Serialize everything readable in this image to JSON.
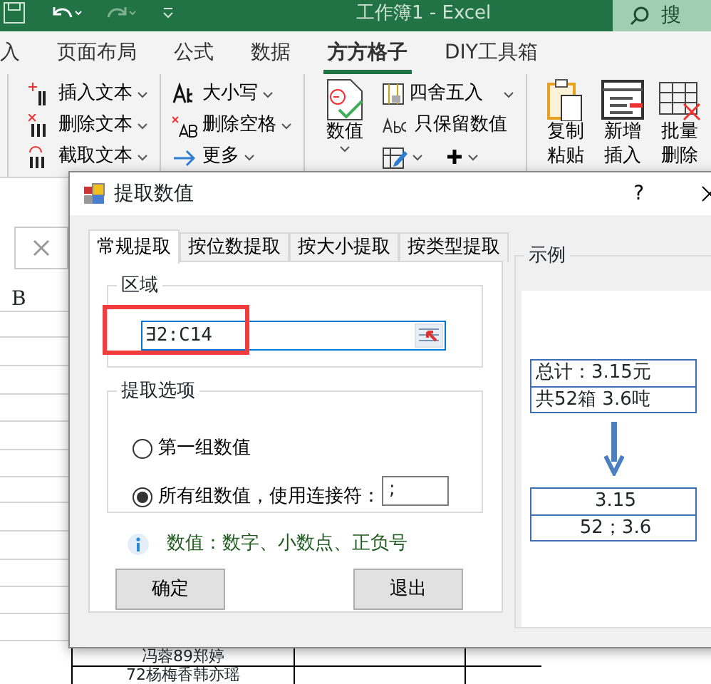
{
  "window": {
    "title": "工作簿1  -  Excel",
    "search": "搜"
  },
  "ribbon_tabs": [
    {
      "label": "入",
      "selected": false
    },
    {
      "label": "页面布局",
      "selected": false
    },
    {
      "label": "公式",
      "selected": false
    },
    {
      "label": "数据",
      "selected": false
    },
    {
      "label": "方方格子",
      "selected": true
    },
    {
      "label": "DIY工具箱",
      "selected": false
    }
  ],
  "ribbon_groups": [
    {
      "kind": "small",
      "items": [
        {
          "label": "插入文本"
        },
        {
          "label": "删除文本"
        },
        {
          "label": "截取文本"
        }
      ]
    },
    {
      "kind": "small",
      "items": [
        {
          "label": "大小写"
        },
        {
          "label": "删除空格"
        },
        {
          "label": "更多"
        }
      ]
    },
    {
      "kind": "mixed",
      "big": {
        "label": "数值"
      },
      "items": [
        {
          "label": "四舍五入"
        },
        {
          "label": "只保留数值"
        }
      ]
    },
    {
      "kind": "big",
      "items": [
        {
          "label": "复制粘贴"
        },
        {
          "label": "新增插入"
        },
        {
          "label": "批量删除"
        }
      ]
    }
  ],
  "sheet": {
    "column_header": "B",
    "cells": [
      "冯蓉89郑婷",
      "72杨梅香韩亦瑶"
    ]
  },
  "dialog": {
    "title": "提取数值",
    "help": "?",
    "tabs": [
      {
        "label": "常规提取",
        "selected": true
      },
      {
        "label": "按位数提取",
        "selected": false
      },
      {
        "label": "按大小提取",
        "selected": false
      },
      {
        "label": "按类型提取",
        "selected": false
      }
    ],
    "range_group": {
      "title": "区域",
      "value": "∃2:C14"
    },
    "options_group": {
      "title": "提取选项",
      "options": [
        {
          "label": "第一组数值",
          "selected": false
        },
        {
          "label": "所有组数值，使用连接符：",
          "selected": true
        }
      ],
      "separator": ";"
    },
    "info": "数值：数字、小数点、正负号",
    "buttons": [
      "确定",
      "退出"
    ],
    "example": {
      "title": "示例",
      "before": [
        "总计：3.15元",
        "共52箱 3.6吨"
      ],
      "after": [
        "3.15",
        "52；3.6"
      ]
    }
  }
}
